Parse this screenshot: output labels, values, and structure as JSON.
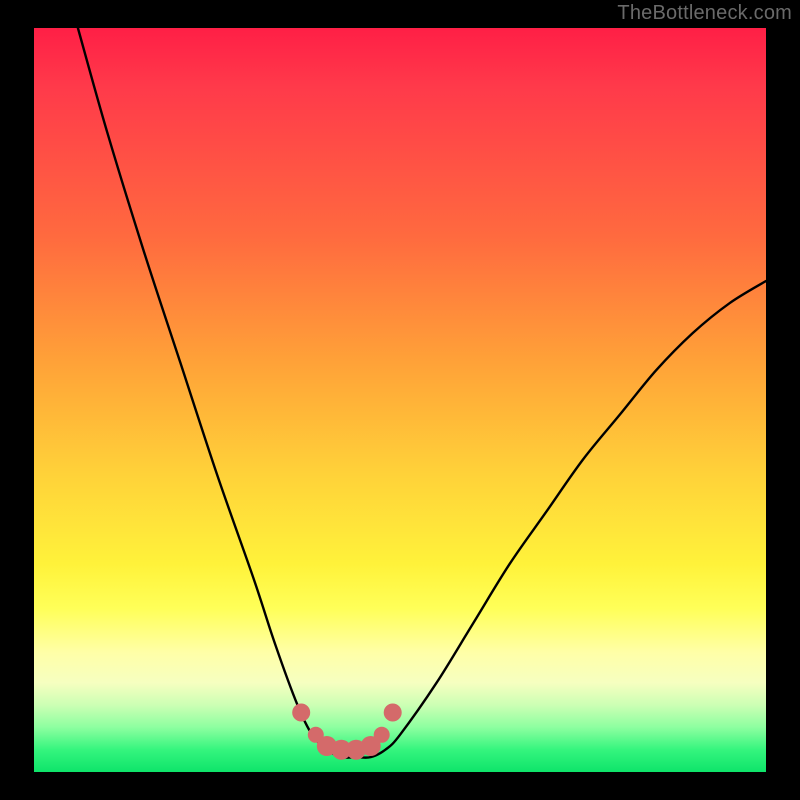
{
  "watermark": "TheBottleneck.com",
  "chart_data": {
    "type": "line",
    "title": "",
    "xlabel": "",
    "ylabel": "",
    "xlim": [
      0,
      100
    ],
    "ylim": [
      0,
      100
    ],
    "series": [
      {
        "name": "bottleneck-curve",
        "x": [
          6,
          10,
          15,
          20,
          25,
          30,
          33,
          36,
          38,
          40,
          42,
          44,
          46,
          48,
          50,
          55,
          60,
          65,
          70,
          75,
          80,
          85,
          90,
          95,
          100
        ],
        "y": [
          100,
          86,
          70,
          55,
          40,
          26,
          17,
          9,
          5,
          3,
          2,
          2,
          2,
          3,
          5,
          12,
          20,
          28,
          35,
          42,
          48,
          54,
          59,
          63,
          66
        ]
      }
    ],
    "markers": {
      "name": "trough-dots",
      "x": [
        36.5,
        38.5,
        40,
        42,
        44,
        46,
        47.5,
        49
      ],
      "y": [
        8,
        5,
        3.5,
        3,
        3,
        3.5,
        5,
        8
      ],
      "size": [
        9,
        8,
        10,
        10,
        10,
        10,
        8,
        9
      ]
    },
    "gradient_stops": [
      {
        "pos": 0.0,
        "color": "#ff1f46"
      },
      {
        "pos": 0.28,
        "color": "#ff6a3f"
      },
      {
        "pos": 0.6,
        "color": "#ffd239"
      },
      {
        "pos": 0.82,
        "color": "#ffff80"
      },
      {
        "pos": 1.0,
        "color": "#0ee46a"
      }
    ]
  }
}
